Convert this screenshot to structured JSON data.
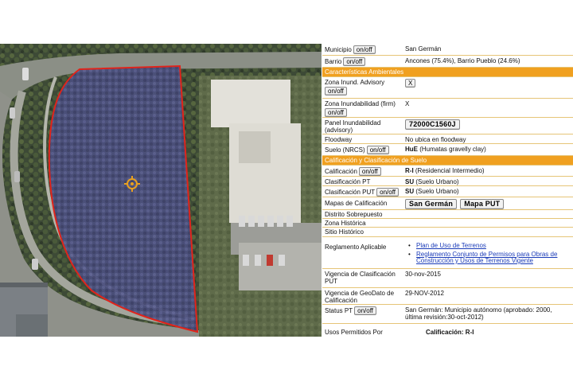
{
  "map": {
    "marker_icon": "crosshair-target-icon",
    "parcel_color": "#e0241b"
  },
  "panel": {
    "accent_color": "#f0a020",
    "municipio": {
      "label": "Municipio",
      "toggle": "on/off",
      "value": "San Germán"
    },
    "barrio": {
      "label": "Barrio",
      "toggle": "on/off",
      "value": "Ancones (75.4%), Barrio Pueblo (24.6%)"
    },
    "section_ambientales": "Características Ambientales",
    "zona_inund_advisory": {
      "label": "Zona Inund. Advisory",
      "toggle": "on/off",
      "value_button": "X"
    },
    "zona_inund_firm": {
      "label": "Zona Inundabilidad (firm)",
      "toggle": "on/off",
      "value": "X"
    },
    "panel_inundabilidad": {
      "label": "Panel Inundabilidad (advisory)",
      "value_button": "72000C1560J"
    },
    "floodway": {
      "label": "Floodway",
      "value": "No ubica en floodway"
    },
    "suelo": {
      "label": "Suelo (NRCS)",
      "toggle": "on/off",
      "code": "HuE",
      "desc": " (Humatas gravelly clay)"
    },
    "section_calificacion": "Calificación y Clasificación de Suelo",
    "calificacion": {
      "label": "Calificación",
      "toggle": "on/off",
      "code": "R-I",
      "desc": " (Residencial Intermedio)"
    },
    "clasificacion_pt": {
      "label": "Clasificación PT",
      "code": "SU",
      "desc": " (Suelo Urbano)"
    },
    "clasificacion_put": {
      "label": "Clasificación PUT",
      "toggle": "on/off",
      "code": "SU",
      "desc": " (Suelo Urbano)"
    },
    "mapas": {
      "label": "Mapas de Calificación",
      "button1": "San Germán",
      "button2": "Mapa PUT"
    },
    "distrito_sobrepuesto": {
      "label": "Distrito Sobrepuesto"
    },
    "zona_historica": {
      "label": "Zona Histórica"
    },
    "sitio_historico": {
      "label": "Sitio Histórico"
    },
    "reglamento": {
      "label": "Reglamento Aplicable",
      "links": [
        "Plan de Uso de Terrenos",
        "Reglamento Conjunto de Permisos para Obras de Construcción y Usos de Terrenos Vigente"
      ]
    },
    "vigencia_clasificacion": {
      "label": "Vigencia de Clasificación PUT",
      "value": "30-nov-2015"
    },
    "vigencia_geodato": {
      "label": "Vigencia de GeoDato de Calificación",
      "value": "29-NOV-2012"
    },
    "status_pt": {
      "label": "Status PT",
      "toggle": "on/off",
      "value": "San Germán: Municipio autónomo (aprobado: 2000, última revisión:30-oct-2012)"
    },
    "usos_permitidos": {
      "label": "Usos Permitidos Por",
      "value": "Calificación: R-I"
    }
  }
}
